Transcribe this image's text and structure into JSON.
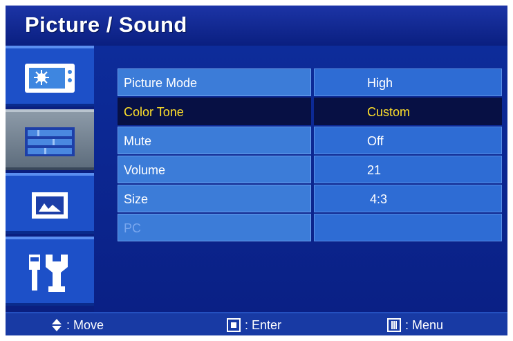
{
  "header": {
    "title": "Picture / Sound"
  },
  "sidebar": {
    "tabs": [
      {
        "icon": "picture-icon",
        "selected": false
      },
      {
        "icon": "sound-equalizer-icon",
        "selected": true
      },
      {
        "icon": "screen-size-icon",
        "selected": false
      },
      {
        "icon": "setup-tools-icon",
        "selected": false
      }
    ]
  },
  "menu": {
    "rows": [
      {
        "label": "Picture Mode",
        "value": "High",
        "state": "normal"
      },
      {
        "label": "Color Tone",
        "value": "Custom",
        "state": "selected"
      },
      {
        "label": "Mute",
        "value": "Off",
        "state": "normal"
      },
      {
        "label": "Volume",
        "value": "21",
        "state": "normal"
      },
      {
        "label": "Size",
        "value": "4:3",
        "state": "normal"
      },
      {
        "label": "PC",
        "value": "",
        "state": "disabled"
      }
    ]
  },
  "footer": {
    "move_label": ": Move",
    "enter_label": ": Enter",
    "menu_label": ": Menu"
  },
  "colors": {
    "background": "#08208a",
    "row_fill": "#3c7cd8",
    "selected_row": "#071044",
    "selected_text": "#ffe02a"
  }
}
